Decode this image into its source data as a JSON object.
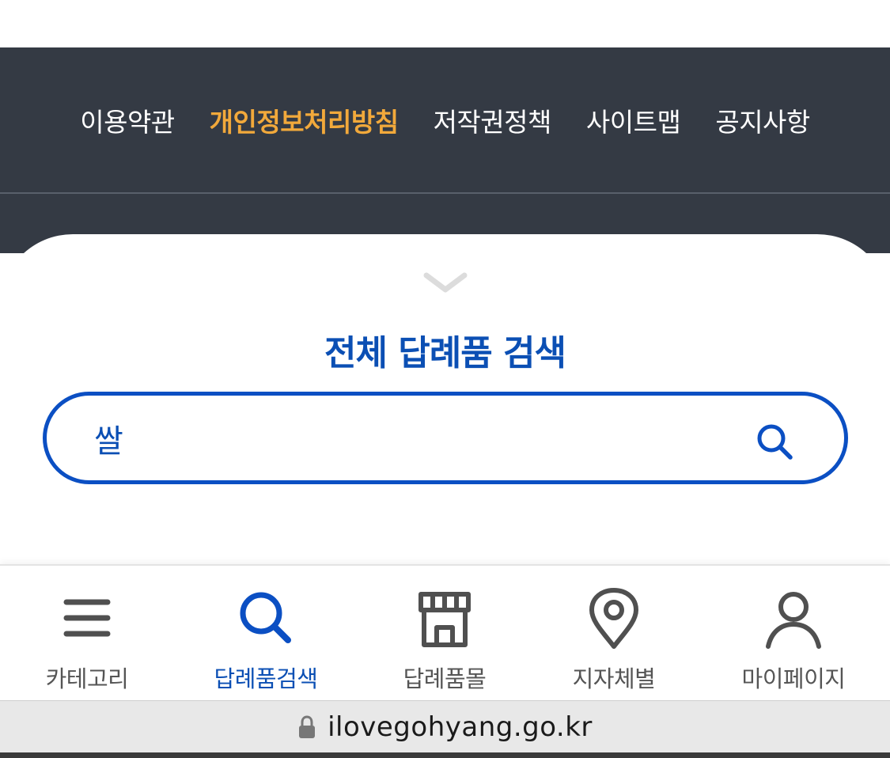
{
  "footer": {
    "links": [
      {
        "label": "이용약관",
        "active": false
      },
      {
        "label": "개인정보처리방침",
        "active": true
      },
      {
        "label": "저작권정책",
        "active": false
      },
      {
        "label": "사이트맵",
        "active": false
      },
      {
        "label": "공지사항",
        "active": false
      }
    ]
  },
  "search_sheet": {
    "title": "전체 답례품 검색",
    "query": "쌀"
  },
  "tabbar": {
    "items": [
      {
        "label": "카테고리",
        "icon": "menu-icon",
        "active": false
      },
      {
        "label": "답례품검색",
        "icon": "search-icon",
        "active": true
      },
      {
        "label": "답례품몰",
        "icon": "store-icon",
        "active": false
      },
      {
        "label": "지자체별",
        "icon": "location-pin-icon",
        "active": false
      },
      {
        "label": "마이페이지",
        "icon": "user-icon",
        "active": false
      }
    ]
  },
  "browser": {
    "url": "ilovegohyang.go.kr",
    "lock_icon": "lock-icon"
  },
  "colors": {
    "footer_bg": "#343a44",
    "footer_active": "#f2a93b",
    "brand_blue": "#0b4fb4",
    "tab_inactive": "#555555"
  }
}
